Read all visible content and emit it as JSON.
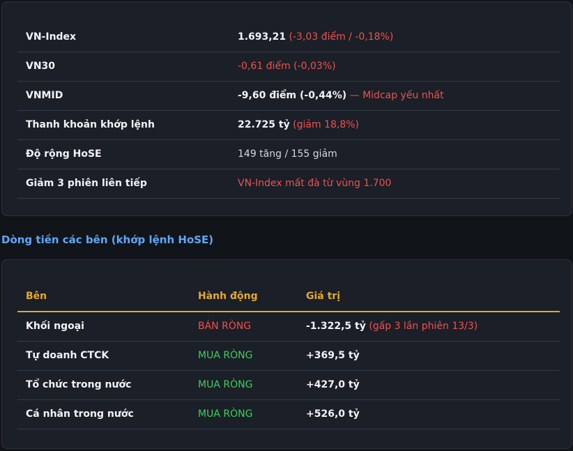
{
  "market": {
    "rows": [
      {
        "label": "VN-Index",
        "value": "1.693,21",
        "note": "(-3,03 điểm / -0,18%)"
      },
      {
        "label": "VN30",
        "value": "",
        "note": "-0,61 điểm (-0,03%)"
      },
      {
        "label": "VNMID",
        "value": "-9,60 điểm (-0,44%)",
        "note": "— Midcap yếu nhất"
      },
      {
        "label": "Thanh khoản khớp lệnh",
        "value": "22.725 tỷ",
        "note": "(giảm 18,8%)"
      },
      {
        "label": "Độ rộng HoSE",
        "value": "149 tăng / 155 giảm",
        "note": ""
      },
      {
        "label": "Giảm 3 phiên liên tiếp",
        "value": "",
        "note": "VN-Index mất đà từ vùng 1.700"
      }
    ]
  },
  "flow": {
    "title": "Dòng tiền các bên (khớp lệnh HoSE)",
    "headers": {
      "party": "Bên",
      "action": "Hành động",
      "value": "Giá trị"
    },
    "rows": [
      {
        "party": "Khối ngoại",
        "action": "BÁN RÒNG",
        "value": "-1.322,5 tỷ",
        "note": "(gấp 3 lần phiên 13/3)"
      },
      {
        "party": "Tự doanh CTCK",
        "action": "MUA RÒNG",
        "value": "+369,5 tỷ",
        "note": ""
      },
      {
        "party": "Tổ chức trong nước",
        "action": "MUA RÒNG",
        "value": "+427,0 tỷ",
        "note": ""
      },
      {
        "party": "Cá nhân trong nước",
        "action": "MUA RÒNG",
        "value": "+526,0 tỷ",
        "note": ""
      }
    ]
  },
  "colors": {
    "background": "#111419",
    "card": "#1b1f27",
    "negative": "#f0514f",
    "positive": "#3ecf5e",
    "header_accent": "#e5a92e",
    "section_title": "#5fa8f5"
  }
}
